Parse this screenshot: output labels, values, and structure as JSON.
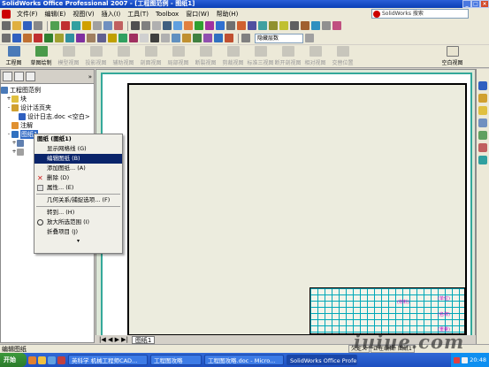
{
  "window": {
    "title": "SolidWorks Office Professional 2007 - [工程图范例 - 图纸1]",
    "minimize": "_",
    "maximize": "□",
    "close": "×"
  },
  "menu": {
    "items": [
      "文件(F)",
      "编辑(E)",
      "视图(V)",
      "插入(I)",
      "工具(T)",
      "Toolbox",
      "窗口(W)",
      "帮助(H)"
    ],
    "search_label": "SolidWorks 搜索"
  },
  "toolbar": {
    "layer_combo": "隐藏层数"
  },
  "command_manager": {
    "items": [
      {
        "label": "工程图",
        "enabled": true
      },
      {
        "label": "草图绘制",
        "enabled": true
      },
      {
        "label": "模型视图",
        "enabled": false
      },
      {
        "label": "投影视图",
        "enabled": false
      },
      {
        "label": "辅助视图",
        "enabled": false
      },
      {
        "label": "剖面视图",
        "enabled": false
      },
      {
        "label": "局部视图",
        "enabled": false
      },
      {
        "label": "断裂视图",
        "enabled": false
      },
      {
        "label": "剪裁视图",
        "enabled": false
      },
      {
        "label": "标准三视图",
        "enabled": false
      },
      {
        "label": "断开剖视图",
        "enabled": false
      },
      {
        "label": "相对视图",
        "enabled": false
      },
      {
        "label": "交替位置",
        "enabled": false
      },
      {
        "label": "空白视图",
        "enabled": true
      }
    ]
  },
  "feature_tree": {
    "root": "工程图范例",
    "items": [
      {
        "label": "块"
      },
      {
        "label": "设计活页夹"
      },
      {
        "label": "设计日志.doc <空白>"
      },
      {
        "label": "注解"
      },
      {
        "label": "图纸1"
      }
    ]
  },
  "context_menu": {
    "header": "图纸 (图纸1)",
    "items": [
      {
        "label": "显示网格线 (G)",
        "selected": false
      },
      {
        "label": "编辑图纸 (B)",
        "selected": true
      },
      {
        "label": "添加图纸... (A)",
        "selected": false
      },
      {
        "label": "删除 (D)",
        "selected": false
      },
      {
        "label": "属性... (E)",
        "selected": false
      },
      {
        "label": "几何关系/捕捉选项... (F)",
        "selected": false
      },
      {
        "label": "转到... (H)",
        "selected": false
      },
      {
        "label": "放大所选范围 (I)",
        "selected": false
      },
      {
        "label": "折叠项目 (J)",
        "selected": false
      }
    ],
    "more": "▾"
  },
  "drawing": {
    "sheet_tab": "图纸1",
    "titleblock_labels": [
      "(材料)",
      "(单位)",
      "(名称)",
      "(重量)"
    ]
  },
  "status": {
    "text": "编辑图纸",
    "cells": [
      "欠定义",
      "正在编辑: 图纸1"
    ]
  },
  "taskbar": {
    "start": "开始",
    "tasks": [
      {
        "label": "英科学 机械工程师CAD...",
        "active": false
      },
      {
        "label": "工程图攻略",
        "active": false
      },
      {
        "label": "工程图攻略.doc - Micro...",
        "active": false
      },
      {
        "label": "SolidWorks Office Profes...",
        "active": true
      }
    ],
    "clock": "20:48"
  },
  "watermark": "iuiue.com",
  "colors": {
    "sheet_border": "#34a89a",
    "menu_selection": "#0a246a",
    "taskbar": "#1d4fc0"
  }
}
